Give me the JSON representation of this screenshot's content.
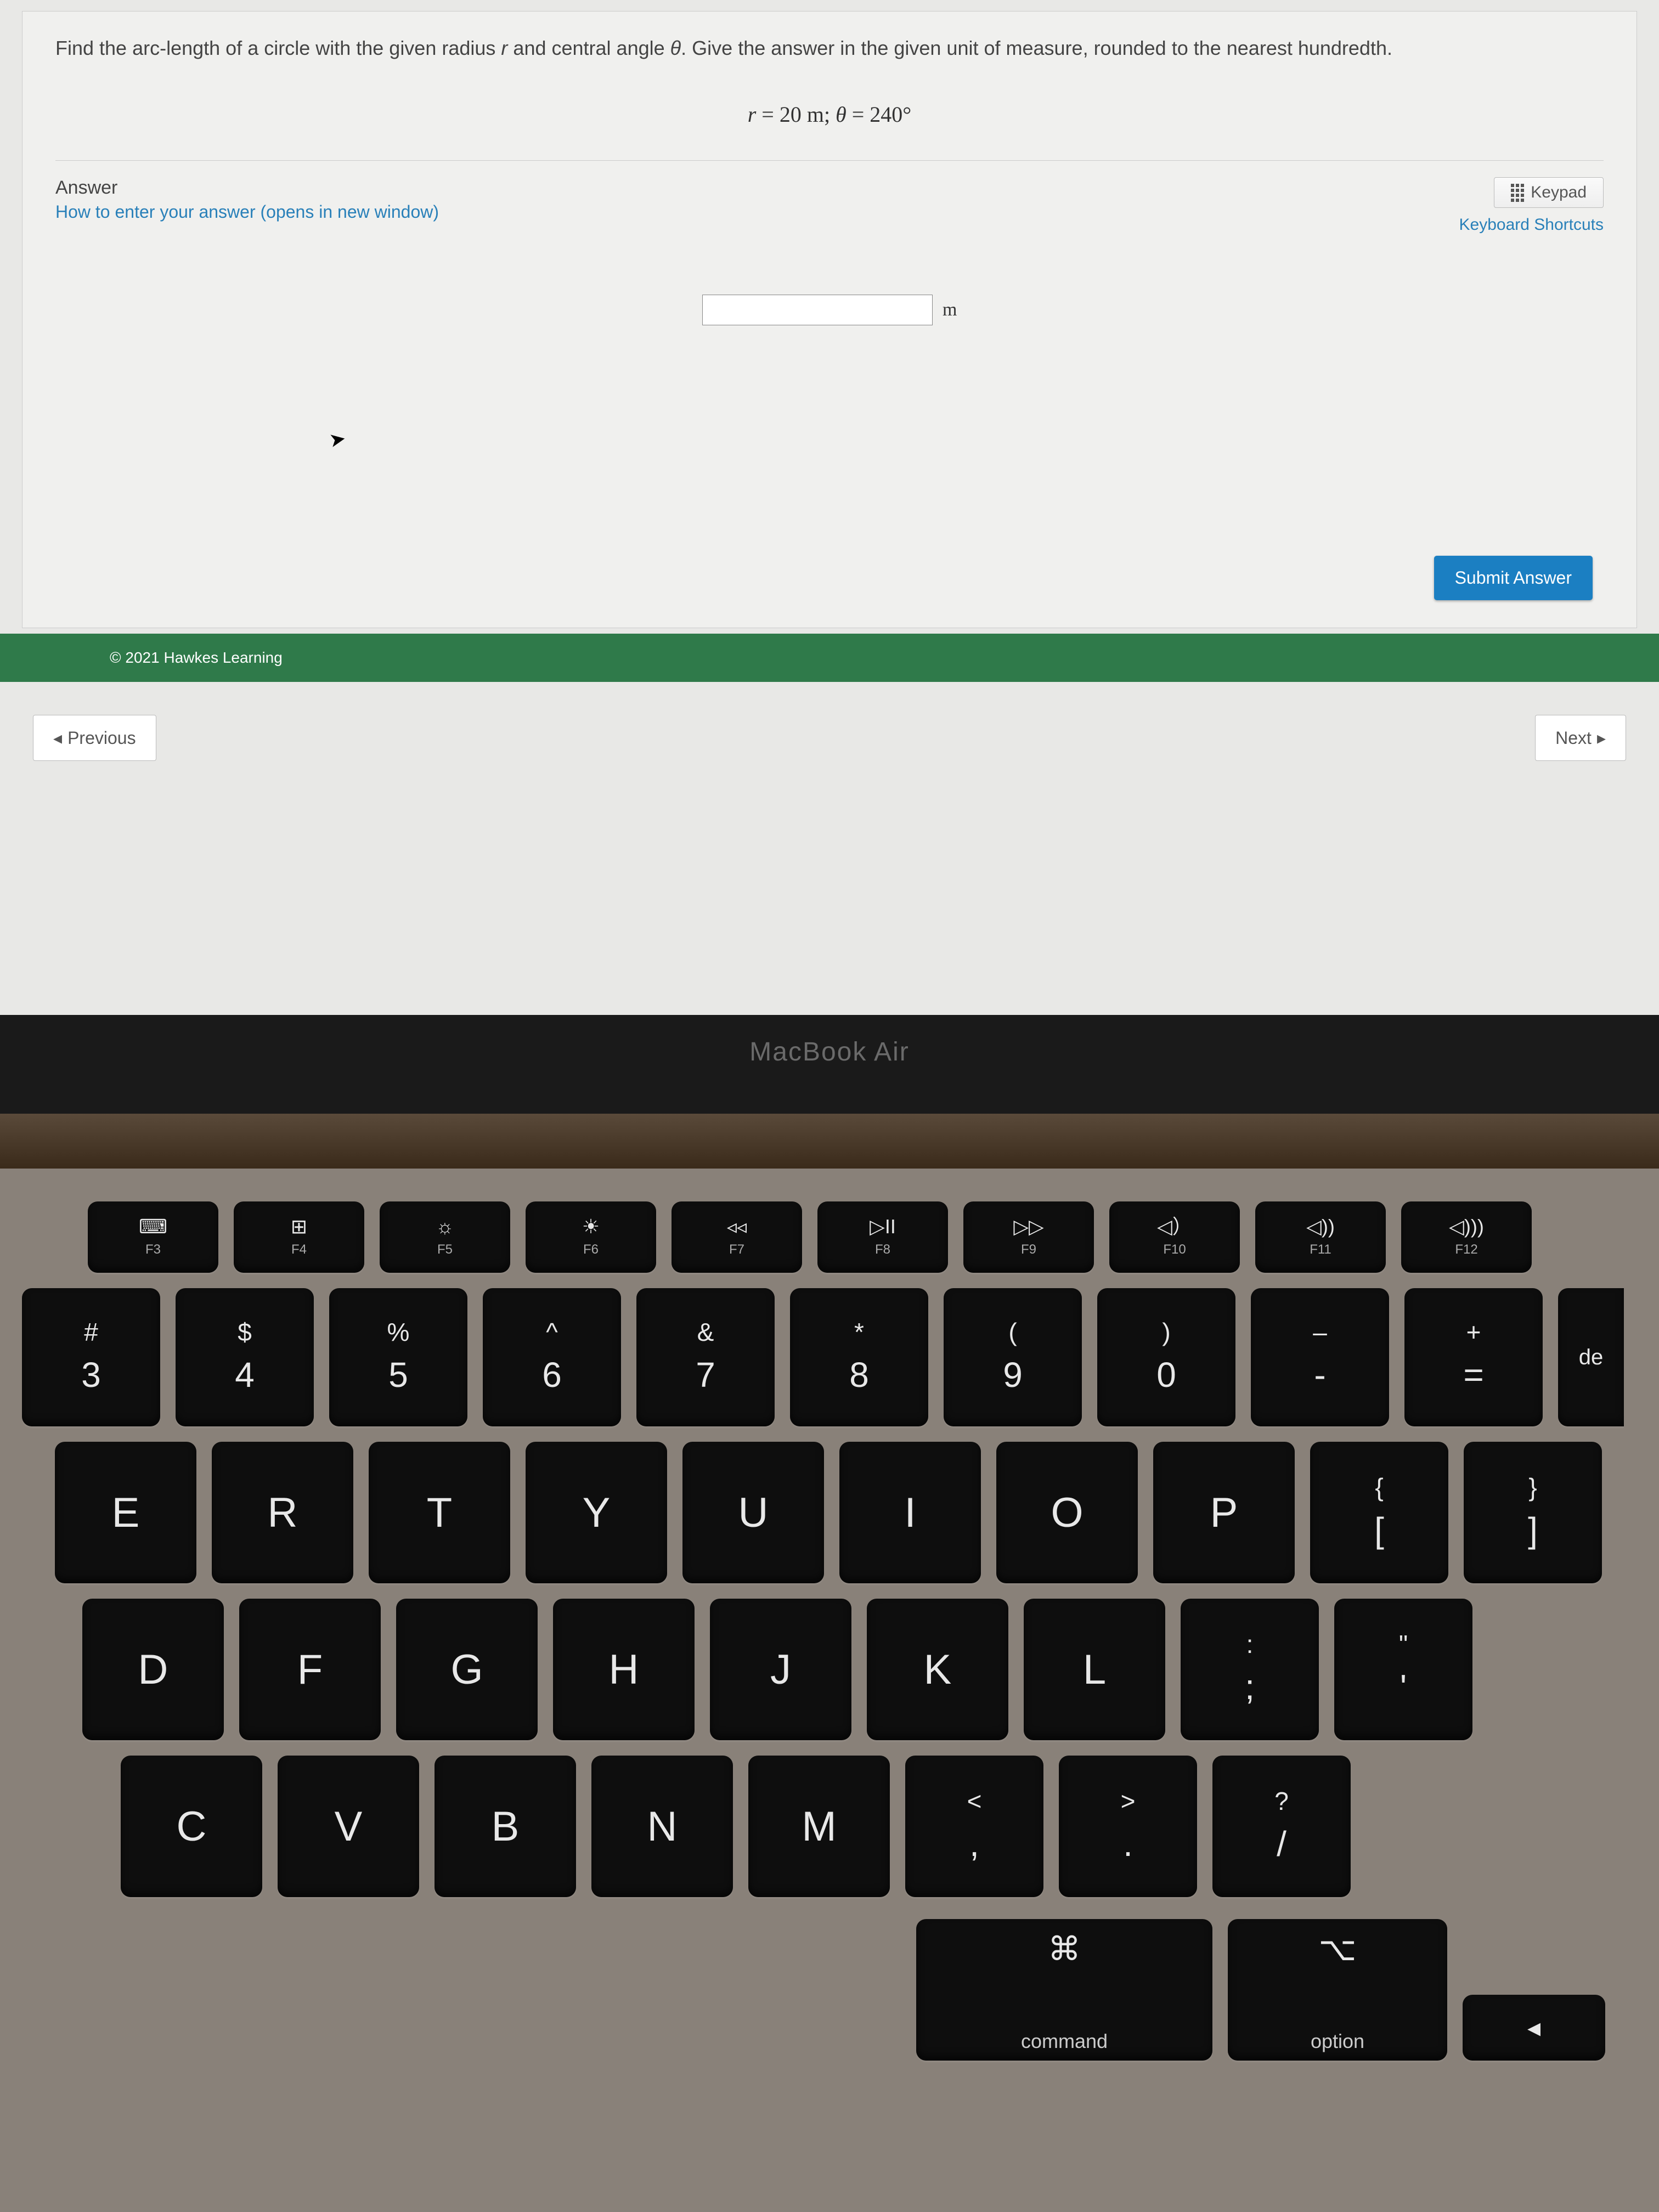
{
  "question": {
    "prefix": "Find the arc-length of a circle with the given radius ",
    "r": "r",
    "mid": " and central angle ",
    "theta": "θ",
    "suffix": ". Give the answer in the given unit of measure, rounded to the nearest hundredth."
  },
  "formula": {
    "r_var": "r",
    "eq1": " = 20 m; ",
    "th_var": "θ",
    "eq2": " = 240°"
  },
  "answer": {
    "label": "Answer",
    "hint": "How to enter your answer (opens in new window)",
    "keypad": "Keypad",
    "shortcuts": "Keyboard Shortcuts",
    "value": "",
    "unit": "m",
    "submit": "Submit Answer"
  },
  "footer": {
    "copyright": "© 2021 Hawkes Learning"
  },
  "nav": {
    "prev": "Previous",
    "next": "Next"
  },
  "laptop": {
    "label": "MacBook Air"
  },
  "keys": {
    "fn": [
      {
        "t": "⌨",
        "b": "F3",
        "icon": "expose"
      },
      {
        "t": "⊞",
        "b": "F4",
        "icon": "launchpad"
      },
      {
        "t": "☼",
        "b": "F5",
        "icon": "dim"
      },
      {
        "t": "☀",
        "b": "F6",
        "icon": "bright"
      },
      {
        "t": "◃◃",
        "b": "F7",
        "icon": "rewind"
      },
      {
        "t": "▷II",
        "b": "F8",
        "icon": "playpause"
      },
      {
        "t": "▷▷",
        "b": "F9",
        "icon": "forward"
      },
      {
        "t": "◁）",
        "b": "F10",
        "icon": "mute"
      },
      {
        "t": "◁))",
        "b": "F11",
        "icon": "voldown"
      },
      {
        "t": "◁)))",
        "b": "F12",
        "icon": "volup"
      }
    ],
    "num": [
      {
        "t": "#",
        "b": "3"
      },
      {
        "t": "$",
        "b": "4"
      },
      {
        "t": "%",
        "b": "5"
      },
      {
        "t": "^",
        "b": "6"
      },
      {
        "t": "&",
        "b": "7"
      },
      {
        "t": "*",
        "b": "8"
      },
      {
        "t": "(",
        "b": "9"
      },
      {
        "t": ")",
        "b": "0"
      },
      {
        "t": "–",
        "b": "-"
      },
      {
        "t": "+",
        "b": "="
      }
    ],
    "de": "de",
    "row_q": [
      "E",
      "R",
      "T",
      "Y",
      "U",
      "I",
      "O",
      "P"
    ],
    "brackets": [
      {
        "t": "{",
        "b": "["
      },
      {
        "t": "}",
        "b": "]"
      }
    ],
    "row_a": [
      "D",
      "F",
      "G",
      "H",
      "J",
      "K",
      "L"
    ],
    "semicolon": {
      "t": ":",
      "b": ";"
    },
    "quote": {
      "t": "\"",
      "b": "'"
    },
    "row_z": [
      "C",
      "V",
      "B",
      "N",
      "M"
    ],
    "comma": {
      "t": "<",
      "b": ","
    },
    "period": {
      "t": ">",
      "b": "."
    },
    "slash": {
      "t": "?",
      "b": "/"
    },
    "mods": {
      "command_sym": "⌘",
      "command": "command",
      "option_sym": "⌥",
      "option": "option",
      "arrow": "◂"
    }
  }
}
